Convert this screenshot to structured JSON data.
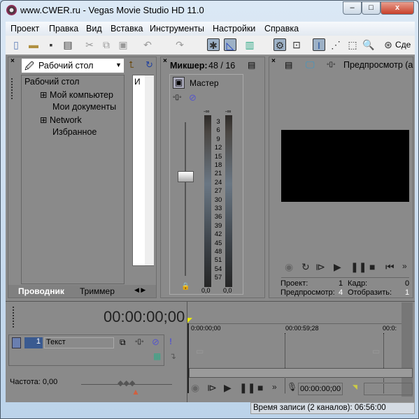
{
  "window": {
    "title": "www.CWER.ru - Vegas Movie Studio HD 11.0",
    "minimize": "–",
    "maximize": "□",
    "close": "x"
  },
  "menu": [
    "Проект",
    "Правка",
    "Вид",
    "Вставка",
    "Инструменты",
    "Настройки",
    "Справка"
  ],
  "toolbar": {
    "render_label": "Сде"
  },
  "explorer": {
    "location": "Рабочий стол",
    "tree": [
      "Рабочий стол",
      "Мой компьютер",
      "Мои документы",
      "Network",
      "Избранное"
    ],
    "list_header": "И",
    "tabs": [
      "Проводник",
      "Триммер"
    ]
  },
  "mixer": {
    "title": "Микшер:",
    "counts": "48 / 16",
    "master": "Мастер",
    "peak_left": "-∞",
    "peak_right": "-∞",
    "scale": [
      "3",
      "6",
      "9",
      "12",
      "15",
      "18",
      "21",
      "24",
      "27",
      "30",
      "33",
      "36",
      "39",
      "42",
      "45",
      "48",
      "51",
      "54",
      "57"
    ],
    "level_left": "0,0",
    "level_right": "0,0"
  },
  "preview": {
    "title": "Предпросмотр (а",
    "project_label": "Проект:",
    "project_value": "1",
    "frame_label": "Кадр:",
    "frame_value": "0",
    "preview_label": "Предпросмотр:",
    "preview_value": "4",
    "display_label": "Отобразить:",
    "display_value": "1"
  },
  "timeline": {
    "time": "00:00:00;00",
    "ruler": [
      "0:00:00;00",
      "00:00:59;28",
      "00:0:"
    ],
    "track_number": "1",
    "track_name": "Текст",
    "rate_label": "Частота: 0,00",
    "cursor_time": "00:00:00;00"
  },
  "status": {
    "record_time": "Время записи (2 каналов): 06:56:00"
  }
}
